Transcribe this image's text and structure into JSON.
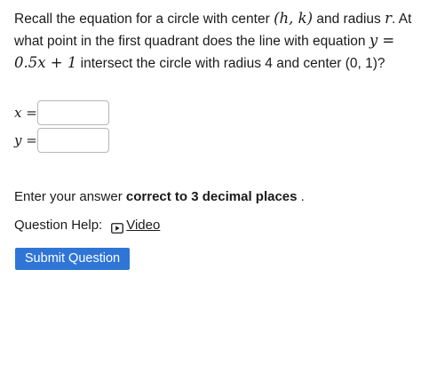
{
  "question": {
    "text_1": "Recall the equation for a circle with center ",
    "center_math": "(h, k)",
    "text_2": " and radius ",
    "radius_math": "r",
    "text_3": ". At what point in the first quadrant does the line with equation ",
    "line_eq_lhs": "y",
    "line_eq_rhs": " = 0.5x + 1",
    "text_4": " intersect the circle with radius 4 and center (0, 1)?"
  },
  "answers": {
    "x_label": "x",
    "x_equals": " =",
    "x_value": "",
    "y_label": "y",
    "y_equals": " =",
    "y_value": ""
  },
  "instruction": {
    "prefix": "Enter your answer ",
    "emphasis": "correct to 3 decimal places",
    "suffix": " ."
  },
  "help": {
    "label": "Question Help:",
    "video_icon": "play-icon",
    "video_label": "Video"
  },
  "submit": {
    "label": "Submit Question",
    "color": "#2f75d6"
  }
}
